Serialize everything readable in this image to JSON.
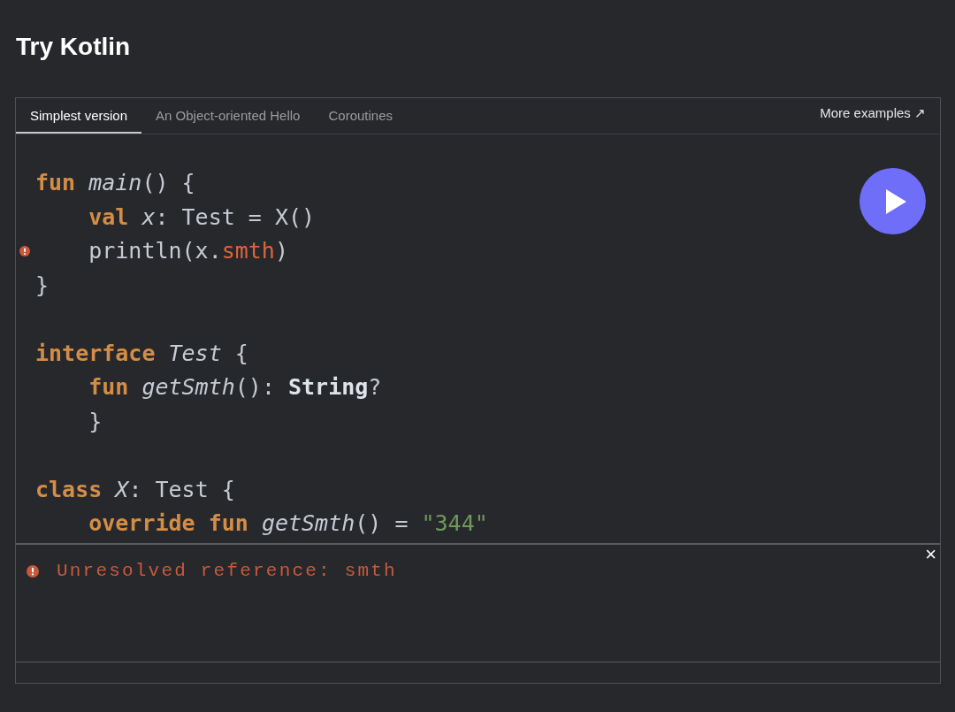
{
  "title": "Try Kotlin",
  "tabs": [
    {
      "label": "Simplest version",
      "selected": true
    },
    {
      "label": "An Object-oriented Hello",
      "selected": false
    },
    {
      "label": "Coroutines",
      "selected": false
    }
  ],
  "more_link": {
    "label": "More examples",
    "icon": "↗"
  },
  "code": {
    "blocks": [
      {
        "lines": [
          {
            "error": false,
            "tokens": [
              {
                "kind": "kw",
                "text": "fun"
              },
              {
                "kind": "decl",
                "text": " main"
              },
              {
                "kind": "plain",
                "text": "() {"
              }
            ]
          },
          {
            "error": false,
            "tokens": [
              {
                "kind": "kw",
                "text": "    val"
              },
              {
                "kind": "decl",
                "text": " x"
              },
              {
                "kind": "plain",
                "text": ": Test = X()"
              }
            ]
          },
          {
            "error": true,
            "tokens": [
              {
                "kind": "plain",
                "text": "    println(x."
              },
              {
                "kind": "err",
                "text": "smth"
              },
              {
                "kind": "plain",
                "text": ")"
              }
            ]
          },
          {
            "error": false,
            "tokens": [
              {
                "kind": "plain",
                "text": "}"
              }
            ]
          }
        ]
      },
      {
        "lines": [
          {
            "error": false,
            "tokens": [
              {
                "kind": "kw",
                "text": "interface"
              },
              {
                "kind": "decl",
                "text": " Test"
              },
              {
                "kind": "plain",
                "text": " {"
              }
            ]
          },
          {
            "error": false,
            "tokens": [
              {
                "kind": "kw",
                "text": "    fun"
              },
              {
                "kind": "decl",
                "text": " getSmth"
              },
              {
                "kind": "plain",
                "text": "(): "
              },
              {
                "kind": "type",
                "text": "String"
              },
              {
                "kind": "plain",
                "text": "?"
              }
            ]
          },
          {
            "error": false,
            "tokens": [
              {
                "kind": "plain",
                "text": "    }"
              }
            ]
          }
        ]
      },
      {
        "lines": [
          {
            "error": false,
            "tokens": [
              {
                "kind": "kw",
                "text": "class"
              },
              {
                "kind": "decl",
                "text": " X"
              },
              {
                "kind": "plain",
                "text": ": Test {"
              }
            ]
          },
          {
            "error": false,
            "tokens": [
              {
                "kind": "kw",
                "text": "    override fun"
              },
              {
                "kind": "decl",
                "text": " getSmth"
              },
              {
                "kind": "plain",
                "text": "() = "
              },
              {
                "kind": "str",
                "text": "\"344\""
              }
            ]
          }
        ]
      }
    ]
  },
  "output": {
    "close": "×",
    "messages": [
      {
        "kind": "error",
        "text": "Unresolved reference: smth"
      }
    ]
  }
}
